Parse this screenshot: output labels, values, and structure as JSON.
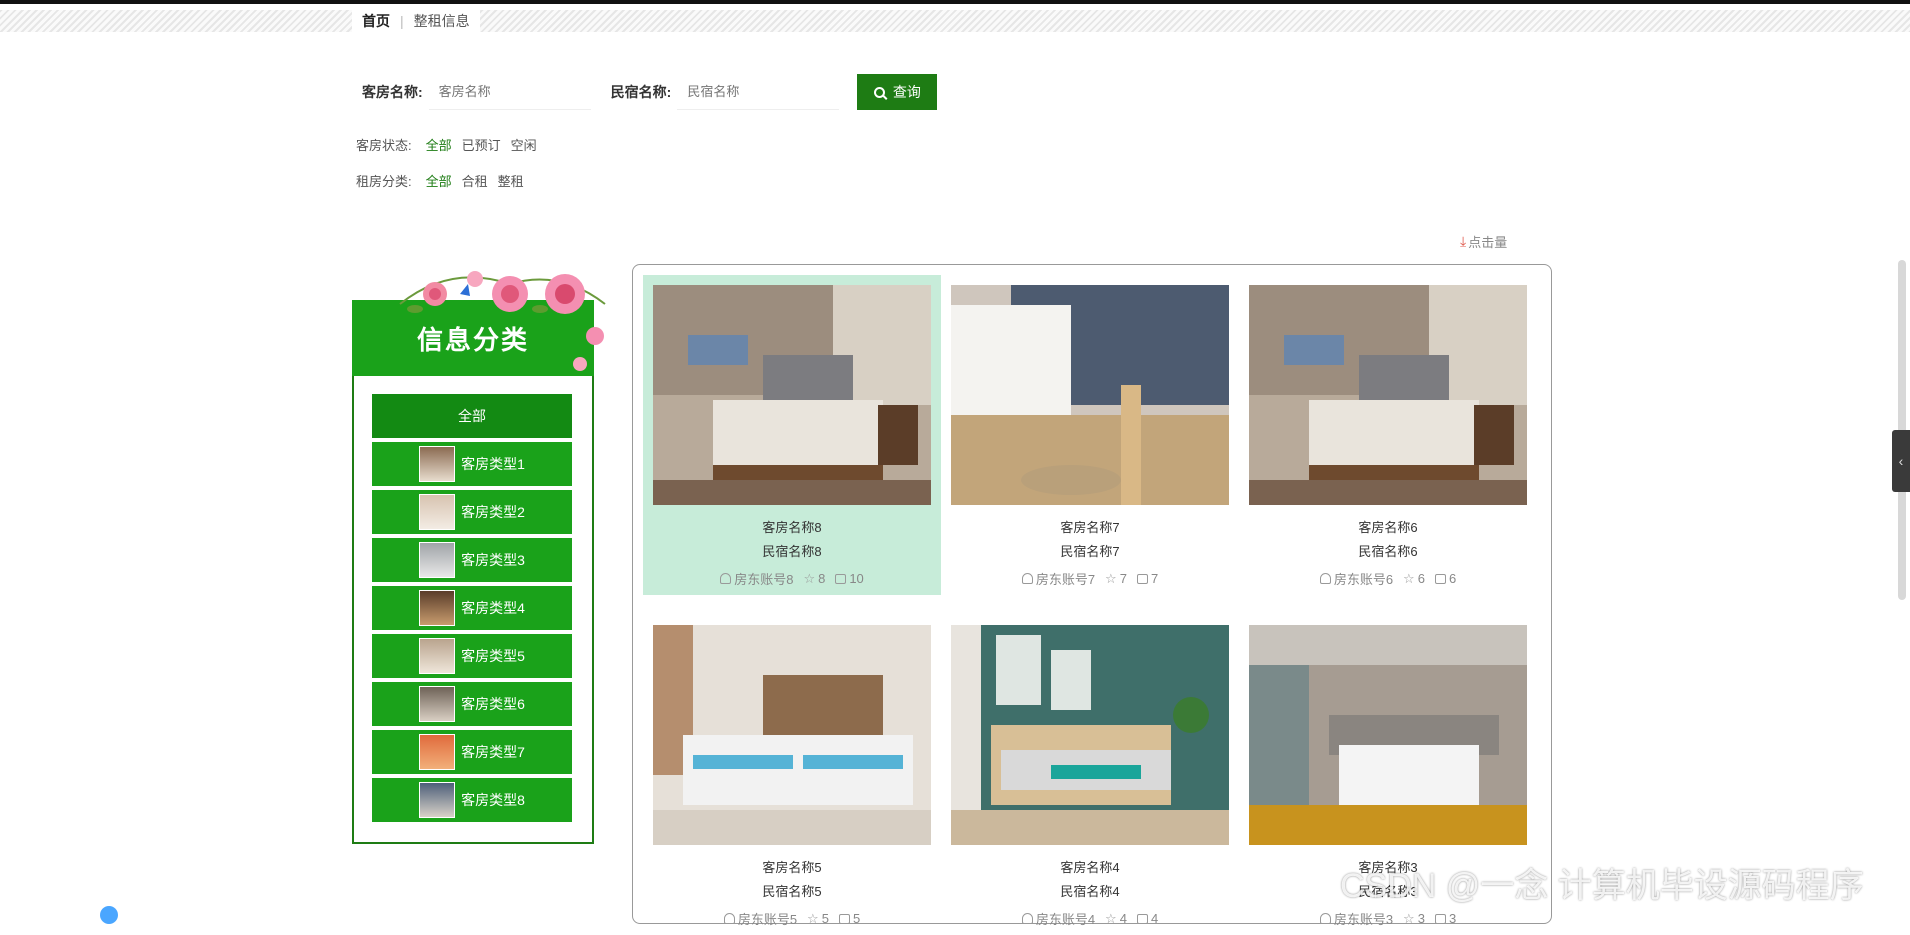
{
  "breadcrumb": {
    "home": "首页",
    "current": "整租信息"
  },
  "search": {
    "room_label": "客房名称:",
    "room_placeholder": "客房名称",
    "homestay_label": "民宿名称:",
    "homestay_placeholder": "民宿名称",
    "button_label": "查询"
  },
  "filters": {
    "status": {
      "label": "客房状态:",
      "options": [
        "全部",
        "已预订",
        "空闲"
      ],
      "active": "全部"
    },
    "category": {
      "label": "租房分类:",
      "options": [
        "全部",
        "合租",
        "整租"
      ],
      "active": "全部"
    }
  },
  "sort": {
    "label": "点击量"
  },
  "sidebar": {
    "title": "信息分类",
    "items": [
      "全部",
      "客房类型1",
      "客房类型2",
      "客房类型3",
      "客房类型4",
      "客房类型5",
      "客房类型6",
      "客房类型7",
      "客房类型8"
    ]
  },
  "cards": [
    {
      "room": "客房名称8",
      "homestay": "民宿名称8",
      "owner": "房东账号8",
      "stars": "8",
      "comments": "10",
      "highlight": true
    },
    {
      "room": "客房名称7",
      "homestay": "民宿名称7",
      "owner": "房东账号7",
      "stars": "7",
      "comments": "7",
      "highlight": false
    },
    {
      "room": "客房名称6",
      "homestay": "民宿名称6",
      "owner": "房东账号6",
      "stars": "6",
      "comments": "6",
      "highlight": false
    },
    {
      "room": "客房名称5",
      "homestay": "民宿名称5",
      "owner": "房东账号5",
      "stars": "5",
      "comments": "5",
      "highlight": false
    },
    {
      "room": "客房名称4",
      "homestay": "民宿名称4",
      "owner": "房东账号4",
      "stars": "4",
      "comments": "4",
      "highlight": false
    },
    {
      "room": "客房名称3",
      "homestay": "民宿名称3",
      "owner": "房东账号3",
      "stars": "3",
      "comments": "3",
      "highlight": false
    }
  ],
  "watermark": "CSDN @一念 计算机毕设源码程序",
  "colors": {
    "primary": "#1e7c14",
    "sidebar": "#1aa21a",
    "highlight": "#c7ecd9"
  }
}
